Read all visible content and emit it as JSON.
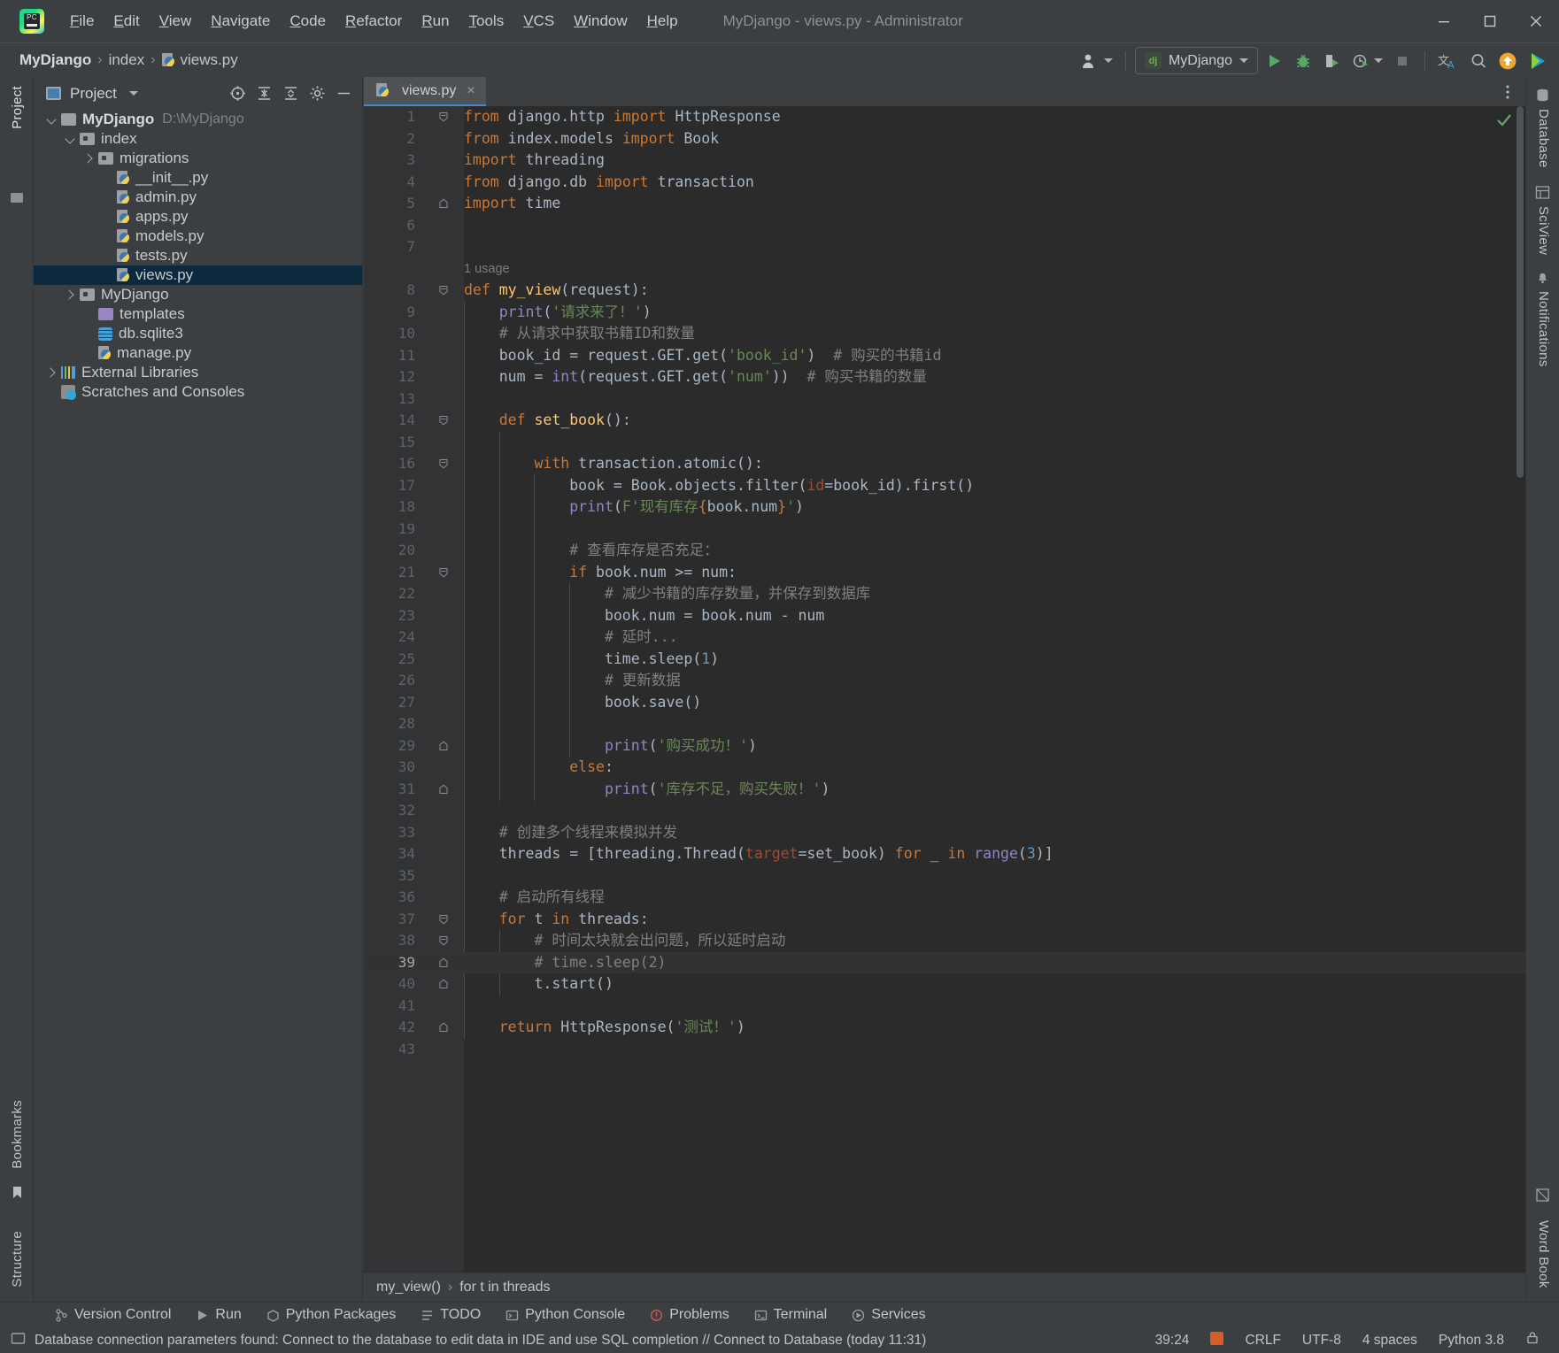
{
  "titlebar": {
    "logo": "pycharm-logo",
    "logo_text": "PC",
    "menus": [
      "File",
      "Edit",
      "View",
      "Navigate",
      "Code",
      "Refactor",
      "Run",
      "Tools",
      "VCS",
      "Window",
      "Help"
    ],
    "window_title": "MyDjango - views.py - Administrator",
    "controls": [
      "minimize",
      "maximize",
      "close"
    ]
  },
  "navbar": {
    "breadcrumbs": [
      "MyDjango",
      "index",
      "views.py"
    ],
    "separator": "›",
    "run_config": "MyDjango",
    "run_config_badge": "dj",
    "actions": [
      "account-icon",
      "run-icon",
      "debug-icon",
      "coverage-icon",
      "profile-icon",
      "stop-icon",
      "translate-icon",
      "search-icon",
      "update-icon",
      "plugin-icon"
    ]
  },
  "left_stripe": {
    "project": "Project",
    "bookmarks": "Bookmarks",
    "structure": "Structure"
  },
  "right_stripe": {
    "database": "Database",
    "sciview": "SciView",
    "notifications": "Notifications",
    "word_book": "Word Book"
  },
  "project_panel": {
    "title": "Project",
    "header_actions": [
      "select-opened-file-icon",
      "expand-all-icon",
      "collapse-all-icon",
      "settings-icon",
      "hide-icon"
    ],
    "tree": [
      {
        "depth": 0,
        "arrow": "down",
        "icon": "folder",
        "name": "MyDjango",
        "bold": true,
        "path": "D:\\MyDjango",
        "selected": false
      },
      {
        "depth": 1,
        "arrow": "down",
        "icon": "folder-module",
        "name": "index",
        "bold": false,
        "path": "",
        "selected": false
      },
      {
        "depth": 2,
        "arrow": "right",
        "icon": "folder-module",
        "name": "migrations",
        "bold": false,
        "path": "",
        "selected": false
      },
      {
        "depth": 3,
        "arrow": "none",
        "icon": "python-file",
        "name": "__init__.py",
        "bold": false,
        "path": "",
        "selected": false
      },
      {
        "depth": 3,
        "arrow": "none",
        "icon": "python-file",
        "name": "admin.py",
        "bold": false,
        "path": "",
        "selected": false
      },
      {
        "depth": 3,
        "arrow": "none",
        "icon": "python-file",
        "name": "apps.py",
        "bold": false,
        "path": "",
        "selected": false
      },
      {
        "depth": 3,
        "arrow": "none",
        "icon": "python-file",
        "name": "models.py",
        "bold": false,
        "path": "",
        "selected": false
      },
      {
        "depth": 3,
        "arrow": "none",
        "icon": "python-file",
        "name": "tests.py",
        "bold": false,
        "path": "",
        "selected": false
      },
      {
        "depth": 3,
        "arrow": "none",
        "icon": "python-file",
        "name": "views.py",
        "bold": false,
        "path": "",
        "selected": true
      },
      {
        "depth": 1,
        "arrow": "right",
        "icon": "folder-module",
        "name": "MyDjango",
        "bold": false,
        "path": "",
        "selected": false
      },
      {
        "depth": 2,
        "arrow": "none",
        "icon": "folder-plain",
        "name": "templates",
        "bold": false,
        "path": "",
        "selected": false
      },
      {
        "depth": 2,
        "arrow": "none",
        "icon": "database-file",
        "name": "db.sqlite3",
        "bold": false,
        "path": "",
        "selected": false
      },
      {
        "depth": 2,
        "arrow": "none",
        "icon": "python-file",
        "name": "manage.py",
        "bold": false,
        "path": "",
        "selected": false
      },
      {
        "depth": 0,
        "arrow": "right",
        "icon": "library",
        "name": "External Libraries",
        "bold": false,
        "path": "",
        "selected": false
      },
      {
        "depth": 0,
        "arrow": "none",
        "icon": "scratch",
        "name": "Scratches and Consoles",
        "bold": false,
        "path": "",
        "selected": false
      }
    ]
  },
  "editor": {
    "tab": {
      "label": "views.py",
      "icon": "python-file",
      "close": "×"
    },
    "inspection_status": "ok-check",
    "usage_hint": {
      "line": 8,
      "text": "1 usage"
    },
    "current_line": 39,
    "breadcrumbs": [
      "my_view()",
      "for t in threads"
    ],
    "breadcrumb_sep": "›",
    "lines": [
      {
        "n": 1,
        "fold": "top",
        "tokens": [
          {
            "t": "from ",
            "c": "kw"
          },
          {
            "t": "django.http ",
            "c": "txt"
          },
          {
            "t": "import ",
            "c": "kw"
          },
          {
            "t": "HttpResponse",
            "c": "txt"
          }
        ]
      },
      {
        "n": 2,
        "fold": "",
        "tokens": [
          {
            "t": "from ",
            "c": "kw"
          },
          {
            "t": "index.models ",
            "c": "txt"
          },
          {
            "t": "import ",
            "c": "kw"
          },
          {
            "t": "Book",
            "c": "txt"
          }
        ]
      },
      {
        "n": 3,
        "fold": "",
        "tokens": [
          {
            "t": "import ",
            "c": "kw"
          },
          {
            "t": "threading",
            "c": "txt"
          }
        ]
      },
      {
        "n": 4,
        "fold": "",
        "tokens": [
          {
            "t": "from ",
            "c": "kw"
          },
          {
            "t": "django.db ",
            "c": "txt"
          },
          {
            "t": "import ",
            "c": "kw"
          },
          {
            "t": "transaction",
            "c": "txt"
          }
        ]
      },
      {
        "n": 5,
        "fold": "bottom",
        "tokens": [
          {
            "t": "import ",
            "c": "kw"
          },
          {
            "t": "time",
            "c": "txt"
          }
        ]
      },
      {
        "n": 6,
        "fold": "",
        "tokens": []
      },
      {
        "n": 7,
        "fold": "",
        "tokens": []
      },
      {
        "n": 8,
        "fold": "top",
        "tokens": [
          {
            "t": "def ",
            "c": "kw"
          },
          {
            "t": "my_view",
            "c": "fn"
          },
          {
            "t": "(request):",
            "c": "txt"
          }
        ]
      },
      {
        "n": 9,
        "fold": "",
        "tokens": [
          {
            "t": "    ",
            "c": "txt"
          },
          {
            "t": "print",
            "c": "bi"
          },
          {
            "t": "(",
            "c": "txt"
          },
          {
            "t": "'请求来了！'",
            "c": "str"
          },
          {
            "t": ")",
            "c": "txt"
          }
        ]
      },
      {
        "n": 10,
        "fold": "",
        "tokens": [
          {
            "t": "    # 从请求中获取书籍ID和数量",
            "c": "cmt"
          }
        ]
      },
      {
        "n": 11,
        "fold": "",
        "tokens": [
          {
            "t": "    book_id = request.GET.get(",
            "c": "txt"
          },
          {
            "t": "'book_id'",
            "c": "str"
          },
          {
            "t": ")",
            "c": "txt"
          },
          {
            "t": "  # 购买的书籍id",
            "c": "cmt"
          }
        ]
      },
      {
        "n": 12,
        "fold": "",
        "tokens": [
          {
            "t": "    num = ",
            "c": "txt"
          },
          {
            "t": "int",
            "c": "bi"
          },
          {
            "t": "(request.GET.get(",
            "c": "txt"
          },
          {
            "t": "'num'",
            "c": "str"
          },
          {
            "t": "))",
            "c": "txt"
          },
          {
            "t": "  # 购买书籍的数量",
            "c": "cmt"
          }
        ]
      },
      {
        "n": 13,
        "fold": "",
        "tokens": []
      },
      {
        "n": 14,
        "fold": "top",
        "tokens": [
          {
            "t": "    ",
            "c": "txt"
          },
          {
            "t": "def ",
            "c": "kw"
          },
          {
            "t": "set_book",
            "c": "fn"
          },
          {
            "t": "():",
            "c": "txt"
          }
        ]
      },
      {
        "n": 15,
        "fold": "",
        "tokens": []
      },
      {
        "n": 16,
        "fold": "top",
        "tokens": [
          {
            "t": "        ",
            "c": "txt"
          },
          {
            "t": "with ",
            "c": "kw"
          },
          {
            "t": "transaction.atomic():",
            "c": "txt"
          }
        ]
      },
      {
        "n": 17,
        "fold": "",
        "tokens": [
          {
            "t": "            book = Book.objects.filter(",
            "c": "txt"
          },
          {
            "t": "id",
            "c": "kwarg"
          },
          {
            "t": "=book_id).first()",
            "c": "txt"
          }
        ]
      },
      {
        "n": 18,
        "fold": "",
        "tokens": [
          {
            "t": "            ",
            "c": "txt"
          },
          {
            "t": "print",
            "c": "bi"
          },
          {
            "t": "(",
            "c": "txt"
          },
          {
            "t": "F'现有库存",
            "c": "str"
          },
          {
            "t": "{",
            "c": "fexpr"
          },
          {
            "t": "book.num",
            "c": "txt"
          },
          {
            "t": "}",
            "c": "fexpr"
          },
          {
            "t": "'",
            "c": "str"
          },
          {
            "t": ")",
            "c": "txt"
          }
        ]
      },
      {
        "n": 19,
        "fold": "",
        "tokens": []
      },
      {
        "n": 20,
        "fold": "",
        "tokens": [
          {
            "t": "            # 查看库存是否充足：",
            "c": "cmt"
          }
        ]
      },
      {
        "n": 21,
        "fold": "top",
        "tokens": [
          {
            "t": "            ",
            "c": "txt"
          },
          {
            "t": "if ",
            "c": "kw"
          },
          {
            "t": "book.num >= num:",
            "c": "txt"
          }
        ]
      },
      {
        "n": 22,
        "fold": "",
        "tokens": [
          {
            "t": "                # 减少书籍的库存数量，并保存到数据库",
            "c": "cmt"
          }
        ]
      },
      {
        "n": 23,
        "fold": "",
        "tokens": [
          {
            "t": "                book.num = book.num - num",
            "c": "txt"
          }
        ]
      },
      {
        "n": 24,
        "fold": "",
        "tokens": [
          {
            "t": "                # 延时...",
            "c": "cmt"
          }
        ]
      },
      {
        "n": 25,
        "fold": "",
        "tokens": [
          {
            "t": "                time.sleep(",
            "c": "txt"
          },
          {
            "t": "1",
            "c": "num"
          },
          {
            "t": ")",
            "c": "txt"
          }
        ]
      },
      {
        "n": 26,
        "fold": "",
        "tokens": [
          {
            "t": "                # 更新数据",
            "c": "cmt"
          }
        ]
      },
      {
        "n": 27,
        "fold": "",
        "tokens": [
          {
            "t": "                book.save()",
            "c": "txt"
          }
        ]
      },
      {
        "n": 28,
        "fold": "",
        "tokens": []
      },
      {
        "n": 29,
        "fold": "bottom",
        "tokens": [
          {
            "t": "                ",
            "c": "txt"
          },
          {
            "t": "print",
            "c": "bi"
          },
          {
            "t": "(",
            "c": "txt"
          },
          {
            "t": "'购买成功！'",
            "c": "str"
          },
          {
            "t": ")",
            "c": "txt"
          }
        ]
      },
      {
        "n": 30,
        "fold": "",
        "tokens": [
          {
            "t": "            ",
            "c": "txt"
          },
          {
            "t": "else",
            "c": "kw"
          },
          {
            "t": ":",
            "c": "txt"
          }
        ]
      },
      {
        "n": 31,
        "fold": "bottom",
        "tokens": [
          {
            "t": "                ",
            "c": "txt"
          },
          {
            "t": "print",
            "c": "bi"
          },
          {
            "t": "(",
            "c": "txt"
          },
          {
            "t": "'库存不足，购买失败！'",
            "c": "str"
          },
          {
            "t": ")",
            "c": "txt"
          }
        ]
      },
      {
        "n": 32,
        "fold": "",
        "tokens": []
      },
      {
        "n": 33,
        "fold": "",
        "tokens": [
          {
            "t": "    # 创建多个线程来模拟并发",
            "c": "cmt"
          }
        ]
      },
      {
        "n": 34,
        "fold": "",
        "tokens": [
          {
            "t": "    threads = [threading.Thread(",
            "c": "txt"
          },
          {
            "t": "target",
            "c": "kwarg"
          },
          {
            "t": "=set_book) ",
            "c": "txt"
          },
          {
            "t": "for ",
            "c": "kw"
          },
          {
            "t": "_ ",
            "c": "txt"
          },
          {
            "t": "in ",
            "c": "kw"
          },
          {
            "t": "range",
            "c": "bi"
          },
          {
            "t": "(",
            "c": "txt"
          },
          {
            "t": "3",
            "c": "num"
          },
          {
            "t": ")]",
            "c": "txt"
          }
        ]
      },
      {
        "n": 35,
        "fold": "",
        "tokens": []
      },
      {
        "n": 36,
        "fold": "",
        "tokens": [
          {
            "t": "    # 启动所有线程",
            "c": "cmt"
          }
        ]
      },
      {
        "n": 37,
        "fold": "top",
        "tokens": [
          {
            "t": "    ",
            "c": "txt"
          },
          {
            "t": "for ",
            "c": "kw"
          },
          {
            "t": "t ",
            "c": "txt"
          },
          {
            "t": "in ",
            "c": "kw"
          },
          {
            "t": "threads:",
            "c": "txt"
          }
        ]
      },
      {
        "n": 38,
        "fold": "top",
        "tokens": [
          {
            "t": "        # 时间太块就会出问题，所以延时启动",
            "c": "cmt"
          }
        ]
      },
      {
        "n": 39,
        "fold": "bottom",
        "tokens": [
          {
            "t": "        # time.sleep(2)",
            "c": "cmt"
          }
        ]
      },
      {
        "n": 40,
        "fold": "bottom",
        "tokens": [
          {
            "t": "        t.start()",
            "c": "txt"
          }
        ]
      },
      {
        "n": 41,
        "fold": "",
        "tokens": []
      },
      {
        "n": 42,
        "fold": "bottom",
        "tokens": [
          {
            "t": "    ",
            "c": "txt"
          },
          {
            "t": "return ",
            "c": "kw"
          },
          {
            "t": "HttpResponse(",
            "c": "txt"
          },
          {
            "t": "'测试！'",
            "c": "str"
          },
          {
            "t": ")",
            "c": "txt"
          }
        ]
      },
      {
        "n": 43,
        "fold": "",
        "tokens": []
      }
    ]
  },
  "tool_strip": [
    {
      "label": "Version Control",
      "icon": "version-control-icon"
    },
    {
      "label": "Run",
      "icon": "run-icon"
    },
    {
      "label": "Python Packages",
      "icon": "packages-icon"
    },
    {
      "label": "TODO",
      "icon": "todo-icon"
    },
    {
      "label": "Python Console",
      "icon": "console-icon"
    },
    {
      "label": "Problems",
      "icon": "problems-icon"
    },
    {
      "label": "Terminal",
      "icon": "terminal-icon"
    },
    {
      "label": "Services",
      "icon": "services-icon"
    }
  ],
  "statusbar": {
    "message": "Database connection parameters found: Connect to the database to edit data in IDE and use SQL completion // Connect to Database (today 11:31)",
    "caret_position": "39:24",
    "line_separator": "CRLF",
    "encoding": "UTF-8",
    "indent": "4 spaces",
    "interpreter": "Python 3.8",
    "ime_indicator": "ime-icon",
    "lock_indicator": "lock-icon"
  },
  "colors": {
    "accent_blue": "#4a88c7",
    "selection": "#0d293e",
    "editor_bg": "#2b2b2b",
    "panel_bg": "#3c3f41",
    "gutter_bg": "#313335",
    "keyword": "#cc7832",
    "string": "#6a8759",
    "comment": "#808080",
    "number": "#6897bb",
    "function": "#ffc66d",
    "builtin": "#8888c6",
    "text": "#a9b7c6"
  }
}
